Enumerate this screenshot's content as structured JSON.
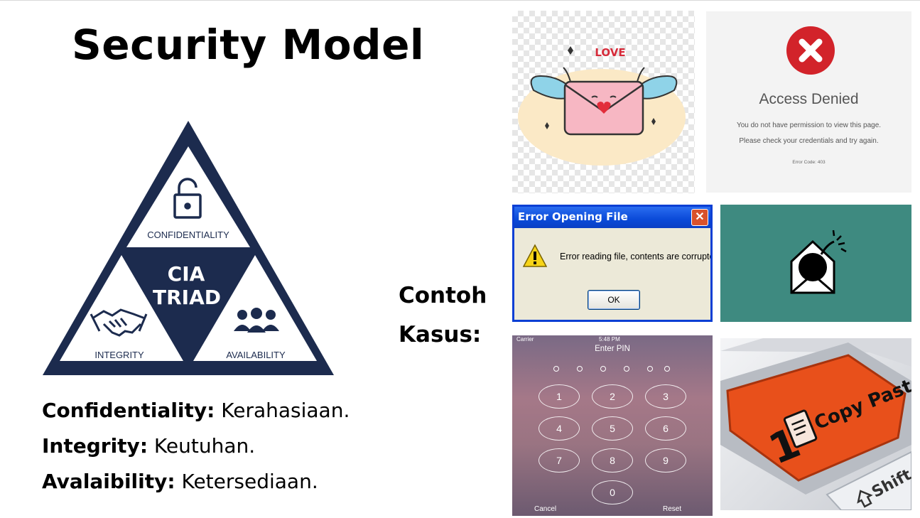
{
  "slide": {
    "title": "Security Model",
    "cia": {
      "center": [
        "CIA",
        "TRIAD"
      ],
      "top_label": "CONFIDENTIALITY",
      "left_label": "INTEGRITY",
      "right_label": "AVAILABILITY",
      "navy": "#1c2b4e",
      "icons": [
        "padlock-icon",
        "handshake-icon",
        "people-group-icon"
      ]
    },
    "definitions": [
      {
        "term": "Confidentiality:",
        "meaning": " Kerahasiaan."
      },
      {
        "term": "Integrity:",
        "meaning": " Keutuhan."
      },
      {
        "term": "Avalaibility:",
        "meaning": " Ketersediaan."
      }
    ],
    "contoh": [
      "Contoh",
      "Kasus:"
    ]
  },
  "images": {
    "love": {
      "word": "LOVE"
    },
    "access_denied": {
      "title": "Access Denied",
      "line1": "You do not have permission to view this page.",
      "line2": "Please check your credentials and try again.",
      "code": "Error Code: 403"
    },
    "error_dialog": {
      "title": "Error Opening File",
      "message": "Error reading file, contents are corrupted.",
      "ok": "OK"
    },
    "pin": {
      "carrier": "Carrier",
      "time": "5:48 PM",
      "heading": "Enter PIN",
      "keys": [
        "1",
        "2",
        "3",
        "4",
        "5",
        "6",
        "7",
        "8",
        "9",
        "0"
      ],
      "cancel": "Cancel",
      "reset": "Reset"
    },
    "copy_paste": {
      "key_label": "Copy Paste",
      "number": "1",
      "shift": "Shift",
      "accent": "#e8501b"
    }
  }
}
